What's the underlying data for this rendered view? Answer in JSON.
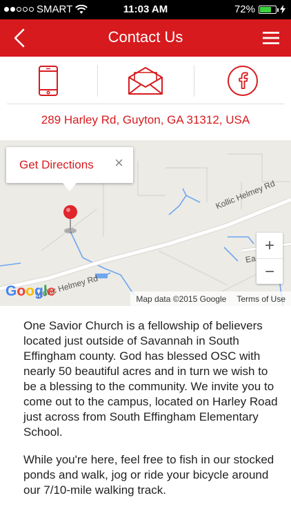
{
  "status": {
    "carrier": "SMART",
    "time": "11:03 AM",
    "battery_text": "72%",
    "battery_level": 0.72,
    "signal_bars": 2
  },
  "nav": {
    "title": "Contact Us",
    "back_icon": "chevron-left-icon",
    "menu_icon": "hamburger-menu-icon"
  },
  "contact_icons": [
    {
      "name": "phone-icon"
    },
    {
      "name": "email-icon"
    },
    {
      "name": "facebook-icon"
    }
  ],
  "address": "289 Harley Rd, Guyton, GA 31312, USA",
  "map": {
    "callout": {
      "label": "Get Directions",
      "close": "×"
    },
    "zoom_in": "+",
    "zoom_out": "−",
    "attribution": "Map data ©2015 Google",
    "terms": "Terms of Use",
    "road_labels": [
      "Kollic Helmey Rd",
      "Kollic Helmey Rd",
      "Ea"
    ],
    "logo": "Google"
  },
  "description": [
    "One Savior Church is a fellowship of believers located just outside of Savannah in South Effingham county. God has blessed OSC with nearly 50 beautiful acres and in turn we wish to be a blessing to the community. We invite you to come out to the campus, located on Harley Road just across from South Effingham Elementary School.",
    "While you're here, feel free to fish in our stocked ponds and walk, jog or ride your bicycle around our 7/10-mile walking track."
  ],
  "colors": {
    "brand_red": "#d61a1e",
    "map_background": "#ecebe6",
    "water": "#6fa6ef"
  }
}
